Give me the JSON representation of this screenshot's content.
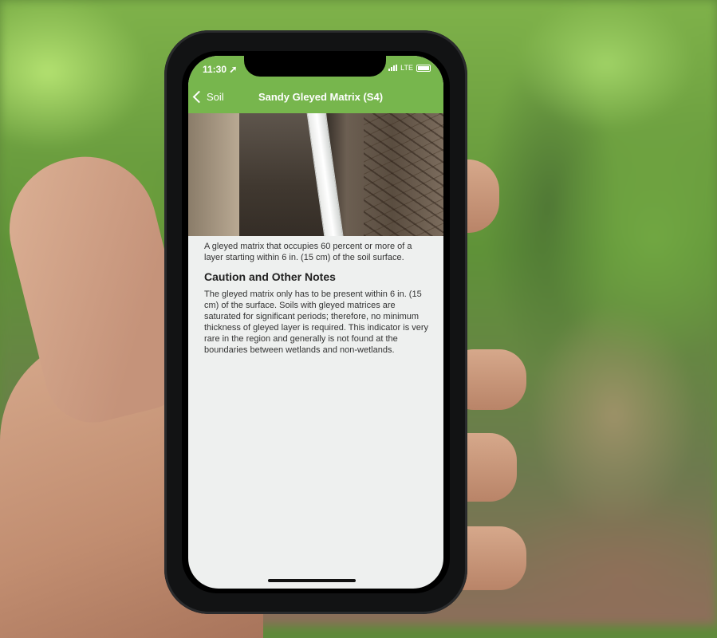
{
  "status_bar": {
    "time": "11:30",
    "network": "LTE"
  },
  "nav": {
    "back_label": "Soil",
    "title": "Sandy Gleyed Matrix (S4)"
  },
  "content": {
    "description": "A gleyed matrix that occupies 60 percent or more of a layer starting within 6 in. (15 cm) of the soil surface.",
    "section_heading": "Caution and Other Notes",
    "section_body": "The gleyed matrix only has to be present within 6 in. (15 cm) of the surface. Soils with gleyed matrices are saturated for significant periods; therefore, no minimum thickness of gleyed layer is required. This indicator is very rare in the region and generally is not found at the boundaries between wetlands and non-wetlands."
  },
  "colors": {
    "nav_green": "#77b64d",
    "screen_bg": "#eef0ef"
  },
  "icons": [
    "location-arrow-icon",
    "signal-icon",
    "battery-icon",
    "chevron-left-icon"
  ]
}
